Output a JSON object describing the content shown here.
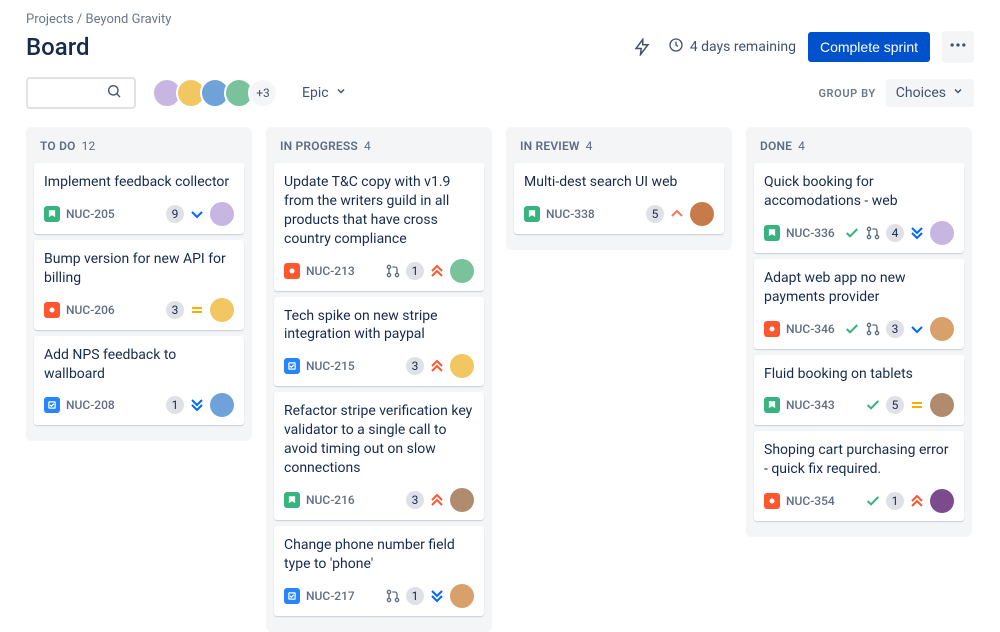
{
  "breadcrumb": {
    "root": "Projects",
    "project": "Beyond Gravity"
  },
  "title": "Board",
  "header": {
    "remaining": "4 days remaining",
    "completeLabel": "Complete sprint"
  },
  "controls": {
    "epicLabel": "Epic",
    "groupByLabel": "GROUP BY",
    "groupByValue": "Choices",
    "avatarMore": "+3"
  },
  "avatarColors": [
    "#C8B6E2",
    "#F2C661",
    "#6FA2D8",
    "#7AC29A",
    "#C1C7D0"
  ],
  "columns": [
    {
      "title": "TO DO",
      "count": "12",
      "cards": [
        {
          "title": "Implement feedback collector",
          "key": "NUC-205",
          "type": "story",
          "badge": "9",
          "priority": "low",
          "avatarColor": "#C8B6E2"
        },
        {
          "title": "Bump version for new API for billing",
          "key": "NUC-206",
          "type": "bug",
          "badge": "3",
          "priority": "medium",
          "avatarColor": "#F2C661"
        },
        {
          "title": "Add NPS feedback to wallboard",
          "key": "NUC-208",
          "type": "task",
          "badge": "1",
          "priority": "lowest",
          "avatarColor": "#6FA2D8"
        }
      ]
    },
    {
      "title": "IN PROGRESS",
      "count": "4",
      "cards": [
        {
          "title": "Update T&C copy with v1.9 from the writers guild in all products that have cross country compliance",
          "key": "NUC-213",
          "type": "bug",
          "pull": true,
          "badge": "1",
          "priority": "highest",
          "avatarColor": "#7AC29A"
        },
        {
          "title": "Tech spike on new stripe integration with paypal",
          "key": "NUC-215",
          "type": "task",
          "badge": "3",
          "priority": "highest",
          "avatarColor": "#F2C661"
        },
        {
          "title": "Refactor stripe verification key validator to a single call to avoid timing out on slow connections",
          "key": "NUC-216",
          "type": "story",
          "badge": "3",
          "priority": "highest",
          "avatarColor": "#B08B6E"
        },
        {
          "title": "Change phone number field type to 'phone'",
          "key": "NUC-217",
          "type": "task",
          "pull": true,
          "badge": "1",
          "priority": "lowest",
          "avatarColor": "#D8A06B"
        }
      ]
    },
    {
      "title": "IN REVIEW",
      "count": "4",
      "cards": [
        {
          "title": "Multi-dest search UI web",
          "key": "NUC-338",
          "type": "story",
          "badge": "5",
          "priority": "mediumUp",
          "avatarColor": "#C77B4A"
        }
      ]
    },
    {
      "title": "DONE",
      "count": "4",
      "cards": [
        {
          "title": "Quick booking for accomodations - web",
          "key": "NUC-336",
          "type": "story",
          "check": true,
          "pull": true,
          "badge": "4",
          "priority": "lowest",
          "avatarColor": "#C8B6E2"
        },
        {
          "title": "Adapt web app no new payments provider",
          "key": "NUC-346",
          "type": "bug",
          "check": true,
          "pull": true,
          "badge": "3",
          "priority": "low",
          "avatarColor": "#D8A06B"
        },
        {
          "title": "Fluid booking on tablets",
          "key": "NUC-343",
          "type": "story",
          "check": true,
          "badge": "5",
          "priority": "medium",
          "avatarColor": "#B08B6E"
        },
        {
          "title": "Shoping cart purchasing error - quick fix required.",
          "key": "NUC-354",
          "type": "bug",
          "check": true,
          "badge": "1",
          "priority": "highest",
          "avatarColor": "#7B4B8E"
        }
      ]
    }
  ]
}
